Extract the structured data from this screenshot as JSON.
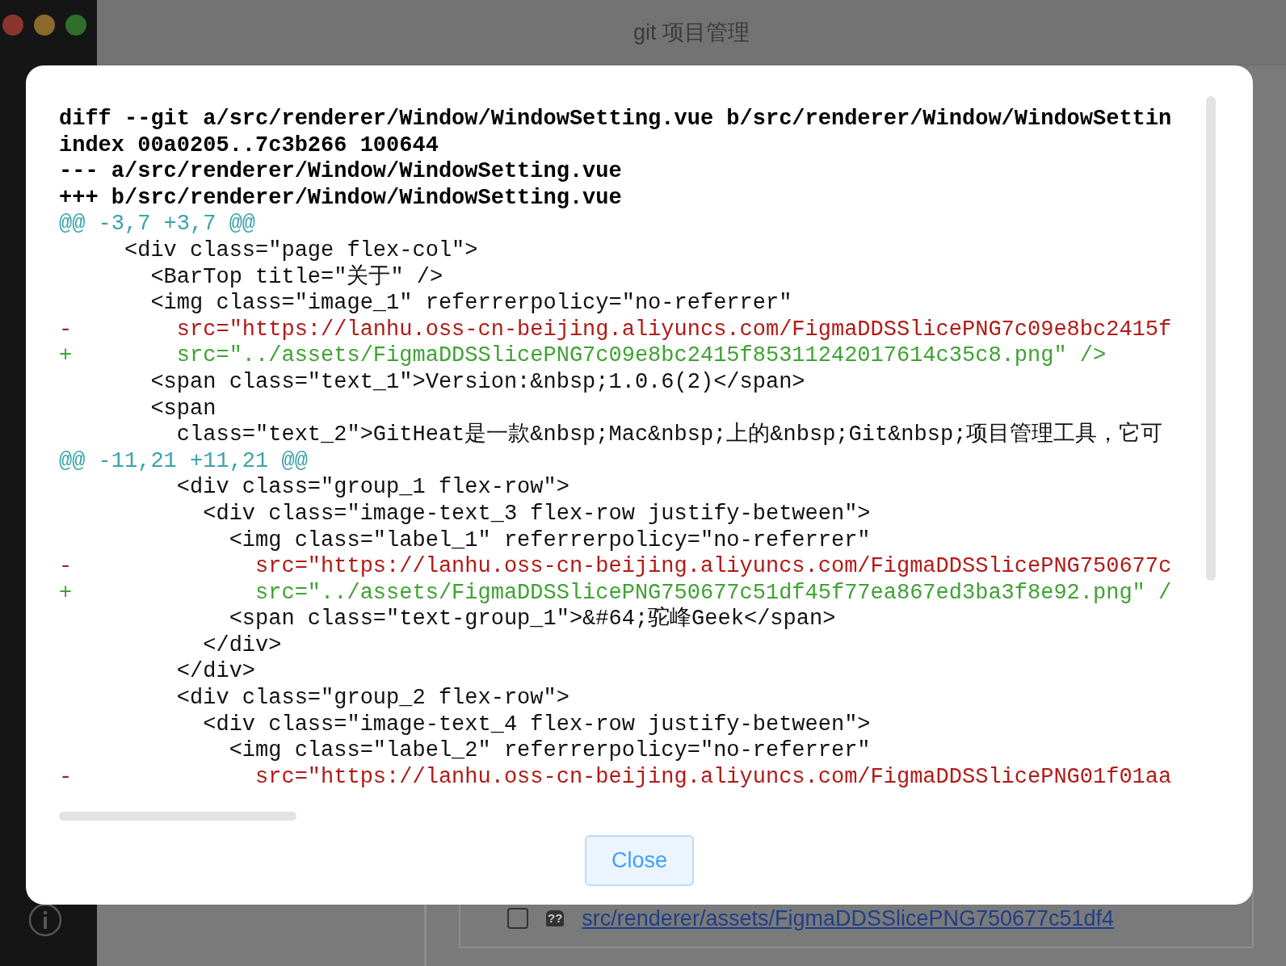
{
  "window": {
    "title": "git 项目管理"
  },
  "background": {
    "file_row": {
      "checked": false,
      "status": "??",
      "path": "src/renderer/assets/FigmaDDSSlicePNG750677c51df4"
    }
  },
  "dialog": {
    "diff_lines": [
      {
        "kind": "header",
        "text": "diff --git a/src/renderer/Window/WindowSetting.vue b/src/renderer/Window/WindowSettin"
      },
      {
        "kind": "header",
        "text": "index 00a0205..7c3b266 100644"
      },
      {
        "kind": "header",
        "text": "--- a/src/renderer/Window/WindowSetting.vue"
      },
      {
        "kind": "header",
        "text": "+++ b/src/renderer/Window/WindowSetting.vue"
      },
      {
        "kind": "hunk",
        "text": "@@ -3,7 +3,7 @@"
      },
      {
        "kind": "context",
        "text": "     <div class=\"page flex-col\">"
      },
      {
        "kind": "context",
        "text": "       <BarTop title=\"关于\" />"
      },
      {
        "kind": "context",
        "text": "       <img class=\"image_1\" referrerpolicy=\"no-referrer\""
      },
      {
        "kind": "removed",
        "text": "-        src=\"https://lanhu.oss-cn-beijing.aliyuncs.com/FigmaDDSSlicePNG7c09e8bc2415f"
      },
      {
        "kind": "added",
        "text": "+        src=\"../assets/FigmaDDSSlicePNG7c09e8bc2415f85311242017614c35c8.png\" />"
      },
      {
        "kind": "context",
        "text": "       <span class=\"text_1\">Version:&nbsp;1.0.6(2)</span>"
      },
      {
        "kind": "context",
        "text": "       <span"
      },
      {
        "kind": "context",
        "text": "         class=\"text_2\">GitHeat是一款&nbsp;Mac&nbsp;上的&nbsp;Git&nbsp;项目管理工具，它可"
      },
      {
        "kind": "hunk",
        "text": "@@ -11,21 +11,21 @@"
      },
      {
        "kind": "context",
        "text": "         <div class=\"group_1 flex-row\">"
      },
      {
        "kind": "context",
        "text": "           <div class=\"image-text_3 flex-row justify-between\">"
      },
      {
        "kind": "context",
        "text": "             <img class=\"label_1\" referrerpolicy=\"no-referrer\""
      },
      {
        "kind": "removed",
        "text": "-              src=\"https://lanhu.oss-cn-beijing.aliyuncs.com/FigmaDDSSlicePNG750677c"
      },
      {
        "kind": "added",
        "text": "+              src=\"../assets/FigmaDDSSlicePNG750677c51df45f77ea867ed3ba3f8e92.png\" /"
      },
      {
        "kind": "context",
        "text": "             <span class=\"text-group_1\">&#64;驼峰Geek</span>"
      },
      {
        "kind": "context",
        "text": "           </div>"
      },
      {
        "kind": "context",
        "text": "         </div>"
      },
      {
        "kind": "context",
        "text": "         <div class=\"group_2 flex-row\">"
      },
      {
        "kind": "context",
        "text": "           <div class=\"image-text_4 flex-row justify-between\">"
      },
      {
        "kind": "context",
        "text": "             <img class=\"label_2\" referrerpolicy=\"no-referrer\""
      },
      {
        "kind": "removed",
        "text": "-              src=\"https://lanhu.oss-cn-beijing.aliyuncs.com/FigmaDDSSlicePNG01f01aa"
      }
    ],
    "button": "Close"
  }
}
